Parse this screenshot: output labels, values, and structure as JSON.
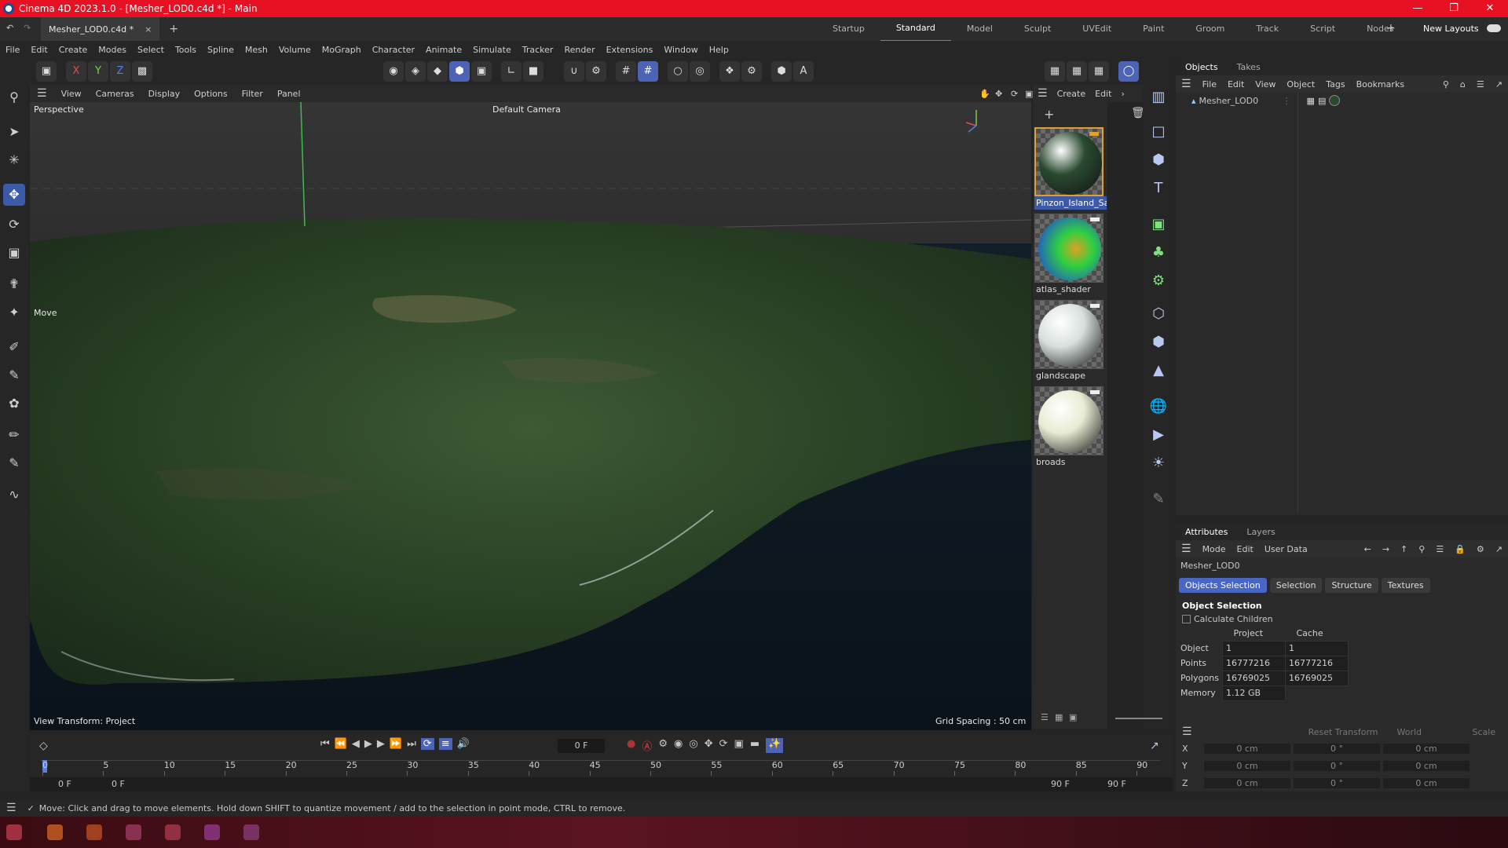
{
  "window": {
    "title": "Cinema 4D 2023.1.0 - [Mesher_LOD0.c4d *] - Main"
  },
  "doc_tab": {
    "label": "Mesher_LOD0.c4d *",
    "close": "×",
    "add": "+"
  },
  "layouts": [
    "Startup",
    "Standard",
    "Model",
    "Sculpt",
    "UVEdit",
    "Paint",
    "Groom",
    "Track",
    "Script",
    "Nodes"
  ],
  "layouts_add": "+",
  "new_layouts": "New Layouts",
  "menu": [
    "File",
    "Edit",
    "Create",
    "Modes",
    "Select",
    "Tools",
    "Spline",
    "Mesh",
    "Volume",
    "MoGraph",
    "Character",
    "Animate",
    "Simulate",
    "Tracker",
    "Render",
    "Extensions",
    "Window",
    "Help"
  ],
  "axis_toggles": [
    "X",
    "Y",
    "Z"
  ],
  "viewport_menu": [
    "View",
    "Cameras",
    "Display",
    "Options",
    "Filter",
    "Panel"
  ],
  "viewport": {
    "label": "Perspective",
    "camera": "Default Camera",
    "tool_hint": "Move",
    "view_transform": "View Transform: Project",
    "grid_spacing": "Grid Spacing : 50 cm"
  },
  "material_menu": [
    "Create",
    "Edit"
  ],
  "materials": [
    {
      "name": "Pinzon_Island_Sat",
      "selected": true,
      "color": "#2a4a30"
    },
    {
      "name": "atlas_shader",
      "selected": false,
      "color": "#30c040"
    },
    {
      "name": "glandscape",
      "selected": false,
      "color": "#d8e0dc"
    },
    {
      "name": "broads",
      "selected": false,
      "color": "#e8ecd4"
    }
  ],
  "objects_panel": {
    "tabs": [
      "Objects",
      "Takes"
    ],
    "menu": [
      "File",
      "Edit",
      "View",
      "Object",
      "Tags",
      "Bookmarks"
    ],
    "items": [
      {
        "name": "Mesher_LOD0"
      }
    ]
  },
  "attributes_panel": {
    "tabs": [
      "Attributes",
      "Layers"
    ],
    "menu": [
      "Mode",
      "Edit",
      "User Data"
    ],
    "object_name": "Mesher_LOD0",
    "subtabs": [
      "Objects Selection",
      "Selection",
      "Structure",
      "Textures"
    ],
    "section_title": "Object Selection",
    "calculate_children": "Calculate Children",
    "headers": [
      "Project",
      "Cache"
    ],
    "rows": [
      {
        "label": "Object",
        "project": "1",
        "cache": "1"
      },
      {
        "label": "Points",
        "project": "16777216",
        "cache": "16777216"
      },
      {
        "label": "Polygons",
        "project": "16769025",
        "cache": "16769025"
      },
      {
        "label": "Memory",
        "project": "1.12 GB",
        "cache": ""
      }
    ]
  },
  "coordinates": {
    "reset_transform": "Reset Transform",
    "space": "World",
    "mode": "Scale",
    "rows": [
      {
        "axis": "X",
        "pos": "0 cm",
        "rot": "0 °",
        "scale": "0 cm"
      },
      {
        "axis": "Y",
        "pos": "0 cm",
        "rot": "0 °",
        "scale": "0 cm"
      },
      {
        "axis": "Z",
        "pos": "0 cm",
        "rot": "0 °",
        "scale": "0 cm"
      }
    ]
  },
  "timeline": {
    "current_frame": "0 F",
    "start": "0 F",
    "range_start": "0 F",
    "range_end": "90 F",
    "end": "90 F",
    "ticks": [
      "0",
      "5",
      "10",
      "15",
      "20",
      "25",
      "30",
      "35",
      "40",
      "45",
      "50",
      "55",
      "60",
      "65",
      "70",
      "75",
      "80",
      "85",
      "90"
    ]
  },
  "status": {
    "text": "Move: Click and drag to move elements. Hold down SHIFT to quantize movement / add to the selection in point mode, CTRL to remove."
  }
}
